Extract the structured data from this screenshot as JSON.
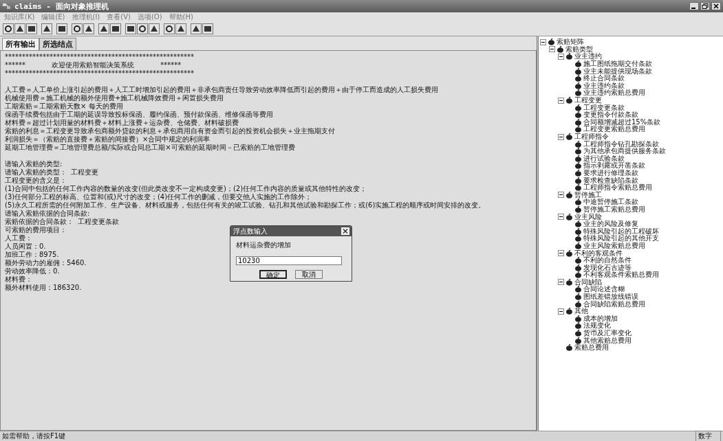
{
  "window": {
    "title": "claims - 面向对象推理机"
  },
  "menu": [
    "知识库(K)",
    "编辑(E)",
    "推理机(I)",
    "查看(V)",
    "选项(O)",
    "帮助(H)"
  ],
  "tabs": [
    {
      "label": "所有输出",
      "selected": true
    },
    {
      "label": "所选结点",
      "selected": false
    }
  ],
  "output_blocks": [
    [
      "*******************************************************",
      "******            欢迎使用索赔智能决策系统            ******",
      "*******************************************************"
    ],
    [
      "人工费＝人工单价上涨引起的费用＋人工工时增加引起的费用＋非承包商责任导致劳动效率降低而引起的费用＋由于停工而造成的人工损失费用",
      "机械使用费＝施工机械的额外使用费+施工机械降效费用＋闲置损失费用",
      "工期索赔＝工期索赔天数× 每天的费用",
      "保函手续费包括由于工期的延误导致投标保函、履约保函、预付款保函、维修保函等费用",
      "材料费＝超过计划用量的材料费＋材料上涨费＋运杂费、仓储费、材料破损费",
      "索赔的利息＝工程变更导致承包商额外贷款的利息＋承包商用自有资金而引起的投资机会损失＋业主拖期支付",
      "利润损失＝（索赔的直接费＋索赔的间接费）×合同中规定的利润率",
      "延期工地管理费＝工地管理费总额/实际或合同总工期×可索赔的延期时间－已索赔的工地管理费"
    ],
    [
      "请输入索赔的类型:",
      "请输入索赔的类型：  工程变更",
      "工程变更的含义是：",
      "(1)合同中包括的任何工作内容的数量的改变(但此类改变不一定构成变更)；(2)任何工作内容的质量或其他特性的改变；",
      "(3)任何部分工程的标高、位置和(或)尺寸的改变；(4)任何工作的删减，但要交他人实施的工作除外；",
      "(5)永久工程所需的任何附加工作、生产设备、材料或服务，包括任何有关的竣工试验、钻孔和其他试验和勘探工作；或(6)实施工程的顺序或时间安排的改变。",
      "请输入索赔依据的合同条款:",
      "索赔依据的合同条款：  工程变更条款",
      "可索赔的费用项目：",
      "人工费：",
      "人员闲置：0.",
      "加班工作：8975.",
      "额外劳动力的雇佣：5460.",
      "劳动效率降低：0.",
      "材料费：",
      "额外材料使用：186320."
    ]
  ],
  "dialog": {
    "title": "浮点数输入",
    "prompt": "材料运杂费的增加",
    "value": "10230",
    "buttons": [
      "确定",
      "取消"
    ]
  },
  "tree": [
    {
      "label": "索赔矩阵",
      "expanded": true,
      "children": [
        {
          "label": "索赔类型",
          "expanded": true,
          "children": [
            {
              "label": "业主违约",
              "expanded": true,
              "children": [
                {
                  "label": "施工图纸拖期交付条款"
                },
                {
                  "label": "业主未能提供现场条款"
                },
                {
                  "label": "终止合同条款"
                },
                {
                  "label": "业主违约条款"
                },
                {
                  "label": "业主违约索赔总费用"
                }
              ]
            },
            {
              "label": "工程变更",
              "expanded": true,
              "children": [
                {
                  "label": "工程变更条款"
                },
                {
                  "label": "变更指令付款条款"
                },
                {
                  "label": "合同额增减超过15%条款"
                },
                {
                  "label": "工程变更索赔总费用"
                }
              ]
            },
            {
              "label": "工程师指令",
              "expanded": true,
              "children": [
                {
                  "label": "工程师指令钻孔勘探条款"
                },
                {
                  "label": "为其他承包商提供服务条款"
                },
                {
                  "label": "进行试验条款"
                },
                {
                  "label": "指示剥露或开凿条款"
                },
                {
                  "label": "要求进行修理条款"
                },
                {
                  "label": "要求检查缺陷条款"
                },
                {
                  "label": "工程师指令索赔总费用"
                }
              ]
            },
            {
              "label": "暂停施工",
              "expanded": true,
              "children": [
                {
                  "label": "中途暂停施工条款"
                },
                {
                  "label": "暂停施工索赔总费用"
                }
              ]
            },
            {
              "label": "业主风险",
              "expanded": true,
              "children": [
                {
                  "label": "业主的风险及修复"
                },
                {
                  "label": "特殊风险引起的工程破坏"
                },
                {
                  "label": "特殊风险引起的其他开支"
                },
                {
                  "label": "业主风险索赔总费用"
                }
              ]
            },
            {
              "label": "不利的客观条件",
              "expanded": true,
              "children": [
                {
                  "label": "不利的自然条件"
                },
                {
                  "label": "发现化石古迹等"
                },
                {
                  "label": "不利客观条件索赔总费用"
                }
              ]
            },
            {
              "label": "合同缺陷",
              "expanded": true,
              "children": [
                {
                  "label": "合同论述含糊"
                },
                {
                  "label": "图纸差错放线错误"
                },
                {
                  "label": "合同缺陷索赔总费用"
                }
              ]
            },
            {
              "label": "其他",
              "expanded": true,
              "children": [
                {
                  "label": "成本的增加"
                },
                {
                  "label": "法规变化"
                },
                {
                  "label": "货币及汇率变化"
                },
                {
                  "label": "其他索赔总费用"
                }
              ]
            },
            {
              "label": "索赔总费用"
            }
          ]
        }
      ]
    }
  ],
  "status_bar": {
    "message": "如需帮助，请按F1键",
    "indicator": "数字"
  }
}
